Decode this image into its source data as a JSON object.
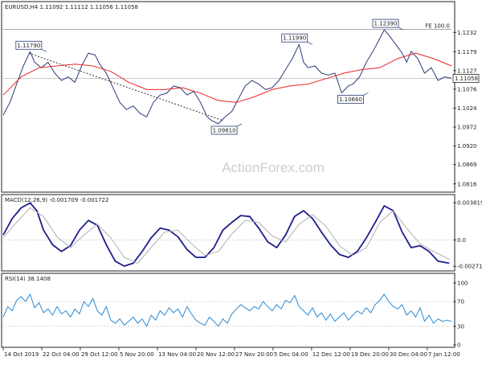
{
  "chart_data": [
    {
      "type": "line",
      "panel": "price",
      "header": "EURUSD,H4  1.11092 1.11112 1.11056 1.11058",
      "fibo_label": "FE 100.0",
      "watermark": "ActionForex.com",
      "ylim": [
        1.08,
        1.129
      ],
      "y_ticks": [
        1.1232,
        1.1179,
        1.1127,
        1.1076,
        1.1024,
        1.0972,
        1.092,
        1.0869,
        1.0816
      ],
      "current_price": 1.11058,
      "fibo_level": 1.124,
      "grid": false,
      "x_tick_labels": [
        "14 Oct 2019",
        "22 Oct 04:00",
        "29 Oct 12:00",
        "5 Nov 20:00",
        "13 Nov 04:00",
        "20 Nov 12:00",
        "27 Nov 20:00",
        "5 Dec 04:00",
        "12 Dec 12:00",
        "19 Dec 20:00",
        "30 Dec 04:00",
        "7 Jan 12:00"
      ],
      "x_index_range": [
        0,
        100
      ],
      "x_tick_index": [
        0,
        8.6,
        17.2,
        25.8,
        34.4,
        43.0,
        51.6,
        60.2,
        68.8,
        77.4,
        86.0,
        94.6
      ],
      "series": [
        {
          "role": "close",
          "color": "#2a3b78",
          "x": [
            0,
            1.5,
            3,
            4.5,
            6,
            7,
            8.5,
            10,
            11.5,
            13,
            14.5,
            16,
            17.5,
            19,
            20.5,
            21.5,
            23,
            24.5,
            26,
            27.5,
            29,
            30.5,
            32,
            33.5,
            35,
            36.5,
            38,
            39.5,
            41,
            42.5,
            44,
            45.5,
            46.5,
            48,
            49.5,
            51,
            52.5,
            54,
            55.5,
            57,
            58.5,
            60,
            61.5,
            63,
            64.5,
            66,
            67,
            68,
            69.5,
            71,
            72.5,
            74,
            75.5,
            77,
            78,
            79.5,
            81,
            82.5,
            84,
            85,
            86,
            87.5,
            89,
            90,
            91,
            92.5,
            94,
            95.5,
            97,
            98.5,
            100
          ],
          "y": [
            1.1005,
            1.104,
            1.109,
            1.114,
            1.1179,
            1.115,
            1.1135,
            1.115,
            1.112,
            1.11,
            1.111,
            1.1095,
            1.114,
            1.1175,
            1.117,
            1.1145,
            1.112,
            1.108,
            1.104,
            1.102,
            1.103,
            1.101,
            1.1,
            1.104,
            1.106,
            1.1065,
            1.1085,
            1.108,
            1.106,
            1.107,
            1.104,
            1.1,
            1.099,
            1.0981,
            1.1,
            1.1015,
            1.105,
            1.1085,
            1.11,
            1.109,
            1.1075,
            1.108,
            1.11,
            1.113,
            1.116,
            1.1199,
            1.115,
            1.1135,
            1.114,
            1.112,
            1.1115,
            1.112,
            1.1066,
            1.1085,
            1.109,
            1.111,
            1.115,
            1.118,
            1.1215,
            1.1239,
            1.1225,
            1.12,
            1.1175,
            1.115,
            1.118,
            1.116,
            1.112,
            1.1135,
            1.11,
            1.111,
            1.1106
          ]
        },
        {
          "role": "moving-average",
          "color": "#e8262a",
          "x": [
            0,
            4,
            8,
            12,
            16,
            20,
            24,
            28,
            32,
            36,
            40,
            44,
            48,
            52,
            56,
            60,
            64,
            68,
            72,
            76,
            80,
            84,
            88,
            92,
            96,
            100
          ],
          "y": [
            1.106,
            1.111,
            1.1135,
            1.114,
            1.1145,
            1.114,
            1.1125,
            1.1095,
            1.1075,
            1.1075,
            1.108,
            1.1065,
            1.1045,
            1.104,
            1.1055,
            1.1075,
            1.1085,
            1.109,
            1.1105,
            1.112,
            1.113,
            1.1135,
            1.116,
            1.1175,
            1.116,
            1.114
          ]
        },
        {
          "role": "trendline",
          "color": "#333333",
          "dashed": true,
          "x": [
            5.7,
            49.0
          ],
          "y": [
            1.1175,
            1.099
          ]
        }
      ],
      "annotations": [
        {
          "text": "1.11790",
          "x": 5.7,
          "y": 1.1179,
          "side": "above"
        },
        {
          "text": "1.09810",
          "x": 49.3,
          "y": 1.0981,
          "side": "below"
        },
        {
          "text": "1.11990",
          "x": 65.0,
          "y": 1.1199,
          "side": "above"
        },
        {
          "text": "1.10660",
          "x": 77.5,
          "y": 1.1066,
          "side": "below"
        },
        {
          "text": "1.12390",
          "x": 85.3,
          "y": 1.1239,
          "side": "above"
        }
      ]
    },
    {
      "type": "line",
      "panel": "macd",
      "header": "MACD(12,26,9) -0.001709 -0.001722",
      "ylim": [
        -0.00295,
        0.004
      ],
      "y_ticks": [
        0.003819,
        0.0,
        -0.002713
      ],
      "y_tick_labels": [
        "0.003819",
        "0.0",
        "-0.002713"
      ],
      "grid": false,
      "series": [
        {
          "role": "macd",
          "color": "#1d1f8c",
          "x": [
            0,
            2,
            4,
            6,
            7.5,
            9,
            11,
            13,
            15,
            17,
            19,
            21,
            23,
            25,
            27,
            29,
            31,
            33,
            35,
            37,
            39,
            41,
            43,
            45,
            47,
            49,
            51,
            53,
            55,
            57,
            59,
            61,
            63,
            65,
            67,
            69,
            71,
            73,
            75,
            77,
            79,
            81,
            83,
            85,
            87,
            89,
            91,
            93,
            95,
            97,
            99.5
          ],
          "y": [
            0.0005,
            0.0022,
            0.0033,
            0.0038,
            0.003,
            0.001,
            -0.0005,
            -0.0012,
            -0.0006,
            0.001,
            0.002,
            0.0015,
            -0.0005,
            -0.0022,
            -0.0027,
            -0.0024,
            -0.0012,
            0.0002,
            0.0012,
            0.001,
            0.0003,
            -0.001,
            -0.0018,
            -0.0018,
            -0.0008,
            0.001,
            0.0018,
            0.0025,
            0.0024,
            0.0012,
            -0.0002,
            -0.0008,
            0.0005,
            0.0024,
            0.003,
            0.0022,
            0.0008,
            -0.0005,
            -0.0015,
            -0.0018,
            -0.0012,
            0.0002,
            0.0018,
            0.0035,
            0.003,
            0.0008,
            -0.0008,
            -0.0006,
            -0.0012,
            -0.0022,
            -0.0024
          ]
        },
        {
          "role": "signal",
          "color": "#b0b0b0",
          "x": [
            0,
            3,
            6,
            9,
            12,
            15,
            18,
            21,
            24,
            27,
            30,
            33,
            36,
            39,
            42,
            45,
            48,
            51,
            54,
            57,
            60,
            63,
            66,
            69,
            72,
            75,
            78,
            81,
            84,
            87,
            90,
            93,
            96,
            99.5
          ],
          "y": [
            0.0002,
            0.0018,
            0.0033,
            0.0024,
            0.0003,
            -0.0008,
            0.0005,
            0.0016,
            0.0002,
            -0.0018,
            -0.0024,
            -0.0008,
            0.0008,
            0.001,
            -0.0004,
            -0.0016,
            -0.0012,
            0.0006,
            0.002,
            0.0018,
            0.0004,
            -0.0002,
            0.0016,
            0.0026,
            0.0014,
            -0.0006,
            -0.0016,
            -0.0008,
            0.0018,
            0.003,
            0.0012,
            -0.0004,
            -0.0012,
            -0.002
          ]
        }
      ]
    },
    {
      "type": "line",
      "panel": "rsi",
      "header": "RSI(14) 38.1408",
      "ylim": [
        0,
        100
      ],
      "y_ticks": [
        100,
        70,
        30,
        0
      ],
      "y_tick_labels": [
        "100",
        "70",
        "30",
        "0"
      ],
      "levels": [
        70,
        30
      ],
      "grid": false,
      "series": [
        {
          "role": "rsi",
          "color": "#2a8ad4",
          "x": [
            0,
            1,
            2,
            3,
            4,
            5,
            6,
            7,
            8,
            9,
            10,
            11,
            12,
            13,
            14,
            15,
            16,
            17,
            18,
            19,
            20,
            21,
            22,
            23,
            24,
            25,
            26,
            27,
            28,
            29,
            30,
            31,
            32,
            33,
            34,
            35,
            36,
            37,
            38,
            39,
            40,
            41,
            42,
            43,
            44,
            45,
            46,
            47,
            48,
            49,
            50,
            51,
            52,
            53,
            54,
            55,
            56,
            57,
            58,
            59,
            60,
            61,
            62,
            63,
            64,
            65,
            66,
            67,
            68,
            69,
            70,
            71,
            72,
            73,
            74,
            75,
            76,
            77,
            78,
            79,
            80,
            81,
            82,
            83,
            84,
            85,
            86,
            87,
            88,
            89,
            90,
            91,
            92,
            93,
            94,
            95,
            96,
            97,
            98,
            99,
            100
          ],
          "y": [
            45,
            62,
            55,
            72,
            78,
            70,
            82,
            60,
            68,
            52,
            58,
            48,
            62,
            50,
            55,
            45,
            58,
            50,
            70,
            62,
            75,
            55,
            48,
            62,
            40,
            35,
            42,
            32,
            38,
            45,
            35,
            42,
            30,
            48,
            40,
            55,
            48,
            60,
            52,
            58,
            45,
            62,
            50,
            40,
            35,
            32,
            45,
            38,
            30,
            42,
            35,
            50,
            58,
            65,
            60,
            55,
            62,
            58,
            70,
            62,
            55,
            65,
            58,
            72,
            68,
            80,
            62,
            55,
            48,
            60,
            45,
            52,
            40,
            50,
            38,
            45,
            52,
            40,
            48,
            55,
            50,
            60,
            52,
            65,
            72,
            82,
            70,
            62,
            58,
            65,
            48,
            55,
            45,
            60,
            38,
            48,
            35,
            42,
            38,
            40,
            38
          ]
        }
      ]
    }
  ]
}
